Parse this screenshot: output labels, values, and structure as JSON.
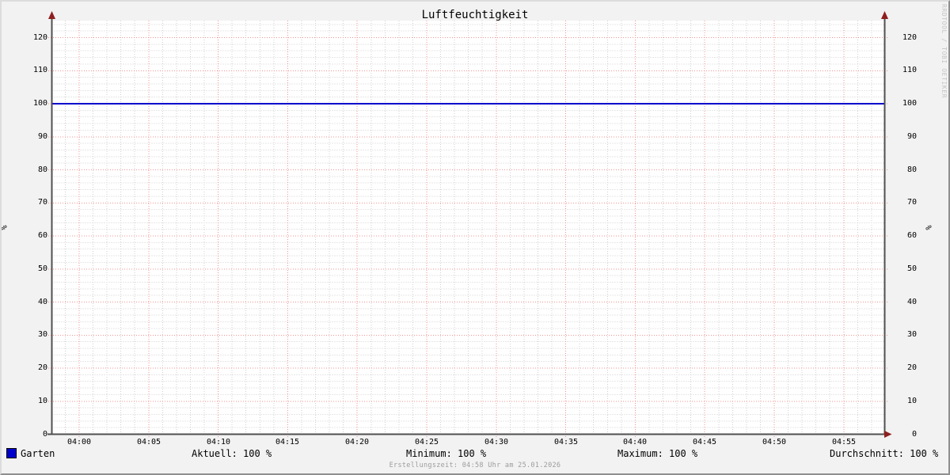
{
  "title": "Luftfeuchtigkeit",
  "watermark": "RRDTOOL / TOBI OETIKER",
  "footer": "Erstellungszeit: 04:58 Uhr am 25.01.2026",
  "y_axis_unit": "%",
  "legend": {
    "series_label": "Garten",
    "series_color": "#0000cc",
    "stats": [
      {
        "label": "Aktuell",
        "value": "100 %",
        "text": "Aktuell: 100 %"
      },
      {
        "label": "Minimum",
        "value": "100 %",
        "text": "Minimum: 100 %"
      },
      {
        "label": "Maximum",
        "value": "100 %",
        "text": "Maximum: 100 %"
      },
      {
        "label": "Durchschnitt",
        "value": "100 %",
        "text": "Durchschnitt: 100 %"
      }
    ]
  },
  "chart_data": {
    "type": "line",
    "title": "Luftfeuchtigkeit",
    "xlabel": "",
    "ylabel": "%",
    "ylim": [
      0,
      125
    ],
    "y_major_step": 10,
    "y_minor_step": 2,
    "y_ticks": [
      0,
      10,
      20,
      30,
      40,
      50,
      60,
      70,
      80,
      90,
      100,
      110,
      120
    ],
    "x_tick_labels": [
      "04:00",
      "04:05",
      "04:10",
      "04:15",
      "04:20",
      "04:25",
      "04:30",
      "04:35",
      "04:40",
      "04:45",
      "04:50",
      "04:55"
    ],
    "x_window": [
      "03:58",
      "04:58"
    ],
    "x_major_step_minutes": 5,
    "x_minor_step_minutes": 1,
    "grid_on": true,
    "legend_position": "bottom",
    "series": [
      {
        "name": "Garten",
        "color": "#0000cc",
        "constant_value": 100,
        "values": [
          {
            "time": "03:58",
            "value": 100
          },
          {
            "time": "04:58",
            "value": 100
          }
        ]
      }
    ],
    "colors": {
      "background": "#f2f2f2",
      "canvas": "#ffffff",
      "minor_grid": "#d0d0d0",
      "major_grid": "#f09494",
      "axis": "#505050",
      "arrow": "#8e1f1f"
    }
  }
}
